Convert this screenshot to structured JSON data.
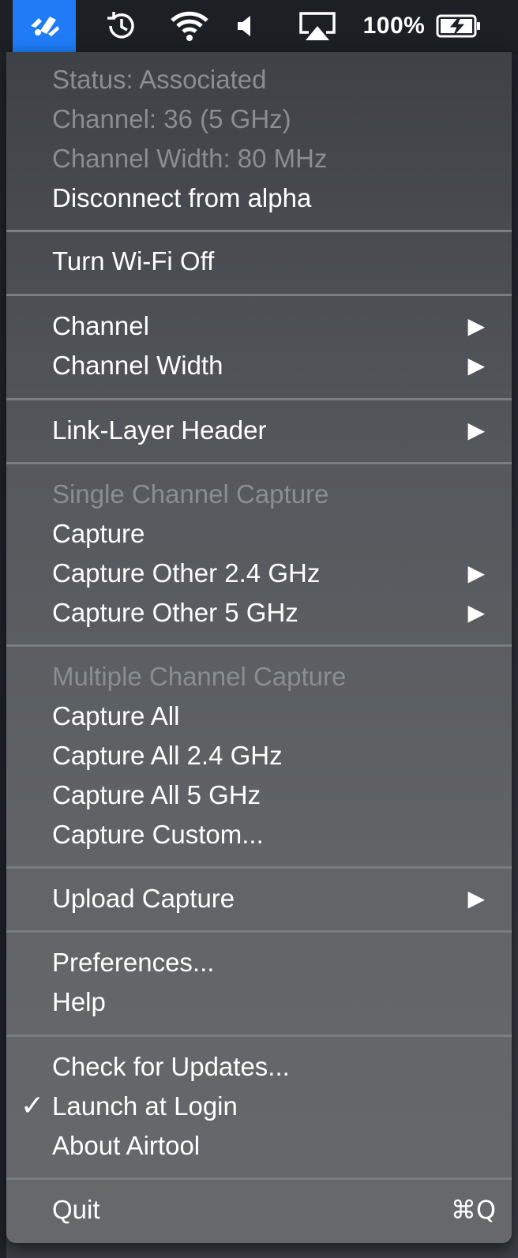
{
  "menubar": {
    "battery_percent": "100%",
    "icons": [
      "airtool-icon",
      "time-machine-icon",
      "wifi-icon",
      "volume-icon",
      "airplay-icon",
      "battery-charging-icon"
    ]
  },
  "menu": {
    "status": "Status: Associated",
    "channel_info": "Channel: 36 (5 GHz)",
    "width_info": "Channel Width: 80 MHz",
    "disconnect": "Disconnect from alpha",
    "wifi_off": "Turn Wi-Fi Off",
    "channel": "Channel",
    "channel_width": "Channel Width",
    "link_layer": "Link-Layer Header",
    "single_header": "Single Channel Capture",
    "capture": "Capture",
    "capture_other_24": "Capture Other 2.4 GHz",
    "capture_other_5": "Capture Other 5 GHz",
    "multi_header": "Multiple Channel Capture",
    "capture_all": "Capture All",
    "capture_all_24": "Capture All 2.4 GHz",
    "capture_all_5": "Capture All 5 GHz",
    "capture_custom": "Capture Custom...",
    "upload_capture": "Upload Capture",
    "preferences": "Preferences...",
    "help": "Help",
    "check_updates": "Check for Updates...",
    "launch_login": "Launch at Login",
    "launch_login_checked": true,
    "about": "About Airtool",
    "quit": "Quit",
    "quit_shortcut": "⌘Q",
    "submenu_arrow": "▶",
    "checkmark": "✓"
  }
}
